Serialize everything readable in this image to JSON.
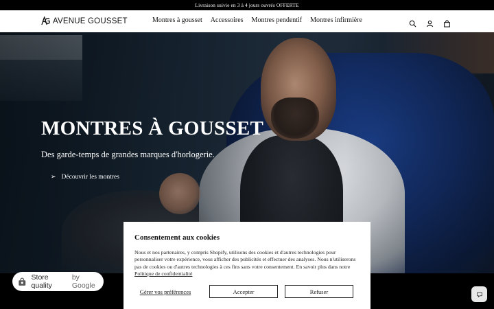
{
  "announcement": {
    "text": "Livraison suivie en 3 à 4 jours ouvrés OFFERTE"
  },
  "header": {
    "logo_text": "AVENUE GOUSSET",
    "nav": [
      "Montres à gousset",
      "Accessoires",
      "Montres pendentif",
      "Montres infirmière"
    ],
    "icons": [
      "search-icon",
      "account-icon",
      "cart-icon"
    ]
  },
  "hero": {
    "title": "MONTRES À GOUSSET",
    "subtitle": "Des garde-temps de grandes marques d'horlogerie.",
    "cta": "Découvrir les montres"
  },
  "store_quality": {
    "label": "Store quality",
    "by": "by Google"
  },
  "cookie": {
    "title": "Consentement aux cookies",
    "text": "Nous et nos partenaires, y compris Shopify, utilisons des cookies et d'autres technologies pour personnaliser votre expérience, vous afficher des publicités et effectuer des analyses. Nous n'utiliserons pas de cookies ou d'autres technologies à ces fins sans votre consentement. En savoir plus dans notre",
    "privacy_link": "Politique de confidentialité",
    "manage_prefs": "Gérer vos préférences",
    "accept": "Accepter",
    "refuse": "Refuser"
  },
  "colors": {
    "header_bg": "#ffffff",
    "announcement_bg": "#000000",
    "chair_blue": "#1b3f8a"
  }
}
